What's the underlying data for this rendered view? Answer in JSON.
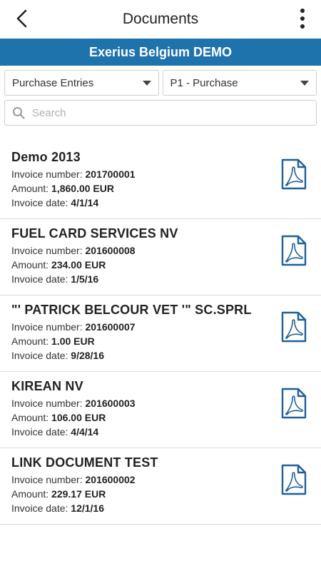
{
  "header": {
    "title": "Documents"
  },
  "company": {
    "name": "Exerius Belgium DEMO"
  },
  "filters": {
    "type_value": "Purchase Entries",
    "journal_value": "P1 - Purchase"
  },
  "search": {
    "placeholder": "Search",
    "value": ""
  },
  "labels": {
    "invoice_number": "Invoice number: ",
    "amount": "Amount: ",
    "invoice_date": "Invoice date: "
  },
  "documents": [
    {
      "name": "Demo 2013",
      "invoice_number": "201700001",
      "amount": "1,860.00 EUR",
      "date": "4/1/14"
    },
    {
      "name": "FUEL CARD SERVICES NV",
      "invoice_number": "201600008",
      "amount": "234.00 EUR",
      "date": "1/5/16"
    },
    {
      "name": "\"' PATRICK BELCOUR VET '\" SC.SPRL",
      "invoice_number": "201600007",
      "amount": "1.00 EUR",
      "date": "9/28/16"
    },
    {
      "name": "KIREAN NV",
      "invoice_number": "201600003",
      "amount": "106.00 EUR",
      "date": "4/4/14"
    },
    {
      "name": "LINK DOCUMENT TEST",
      "invoice_number": "201600002",
      "amount": "229.17 EUR",
      "date": "12/1/16"
    }
  ],
  "icons": {
    "back": "chevron-left-icon",
    "menu": "more-vertical-icon",
    "search": "search-icon",
    "document": "pdf-icon"
  },
  "colors": {
    "brand": "#1f73ad",
    "icon": "#1f5f9a"
  }
}
